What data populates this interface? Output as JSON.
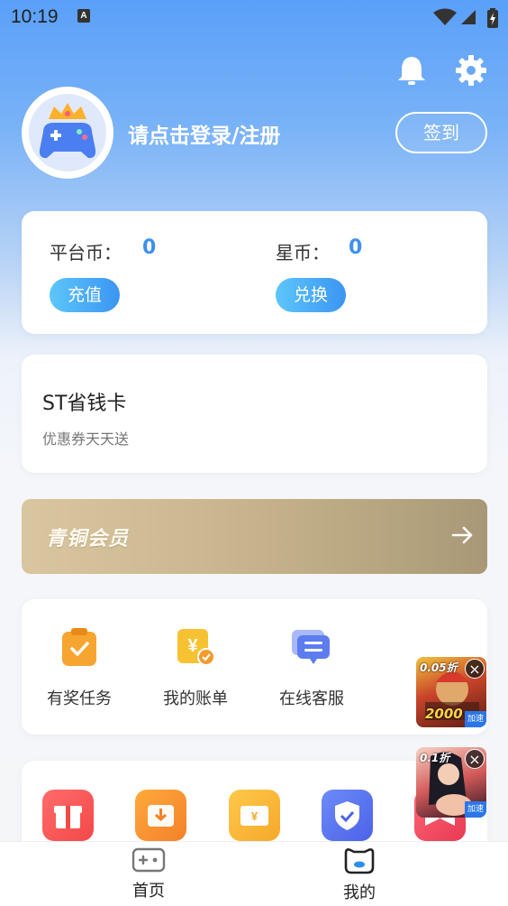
{
  "status_bar": {
    "time": "10:19",
    "notification_icon": "A"
  },
  "header": {
    "icons": [
      "bell-icon",
      "gear-icon"
    ]
  },
  "profile": {
    "login_prompt": "请点击登录/注册",
    "sign_in_button": "签到"
  },
  "wallet": {
    "platform_coin_label": "平台币：",
    "platform_coin_value": "0",
    "star_coin_label": "星币：",
    "star_coin_value": "0",
    "recharge_button": "充值",
    "exchange_button": "兑换"
  },
  "savings_card": {
    "title": "ST省钱卡",
    "subtitle": "优惠券天天送"
  },
  "membership": {
    "label": "青铜会员",
    "arrow_icon": "arrow-right-icon"
  },
  "tools": [
    {
      "label": "有奖任务",
      "icon": "task-clipboard-icon"
    },
    {
      "label": "我的账单",
      "icon": "bill-icon"
    },
    {
      "label": "在线客服",
      "icon": "customer-service-icon"
    }
  ],
  "apps": {
    "icons": [
      "gift-icon",
      "download-icon",
      "coupon-icon",
      "shield-icon",
      "bow-icon"
    ]
  },
  "floating_ads": [
    {
      "tag": "0.05折",
      "amount": "2000",
      "badge": "加速"
    },
    {
      "tag": "0.1折",
      "badge": "加速"
    }
  ],
  "tab_bar": {
    "tabs": [
      {
        "label": "首页",
        "icon": "gamepad-icon"
      },
      {
        "label": "我的",
        "icon": "profile-face-icon"
      }
    ]
  },
  "colors": {
    "accent": "#3d91ee",
    "header_top": "#5aa0f9",
    "vip_gold": "#c9b58d"
  }
}
